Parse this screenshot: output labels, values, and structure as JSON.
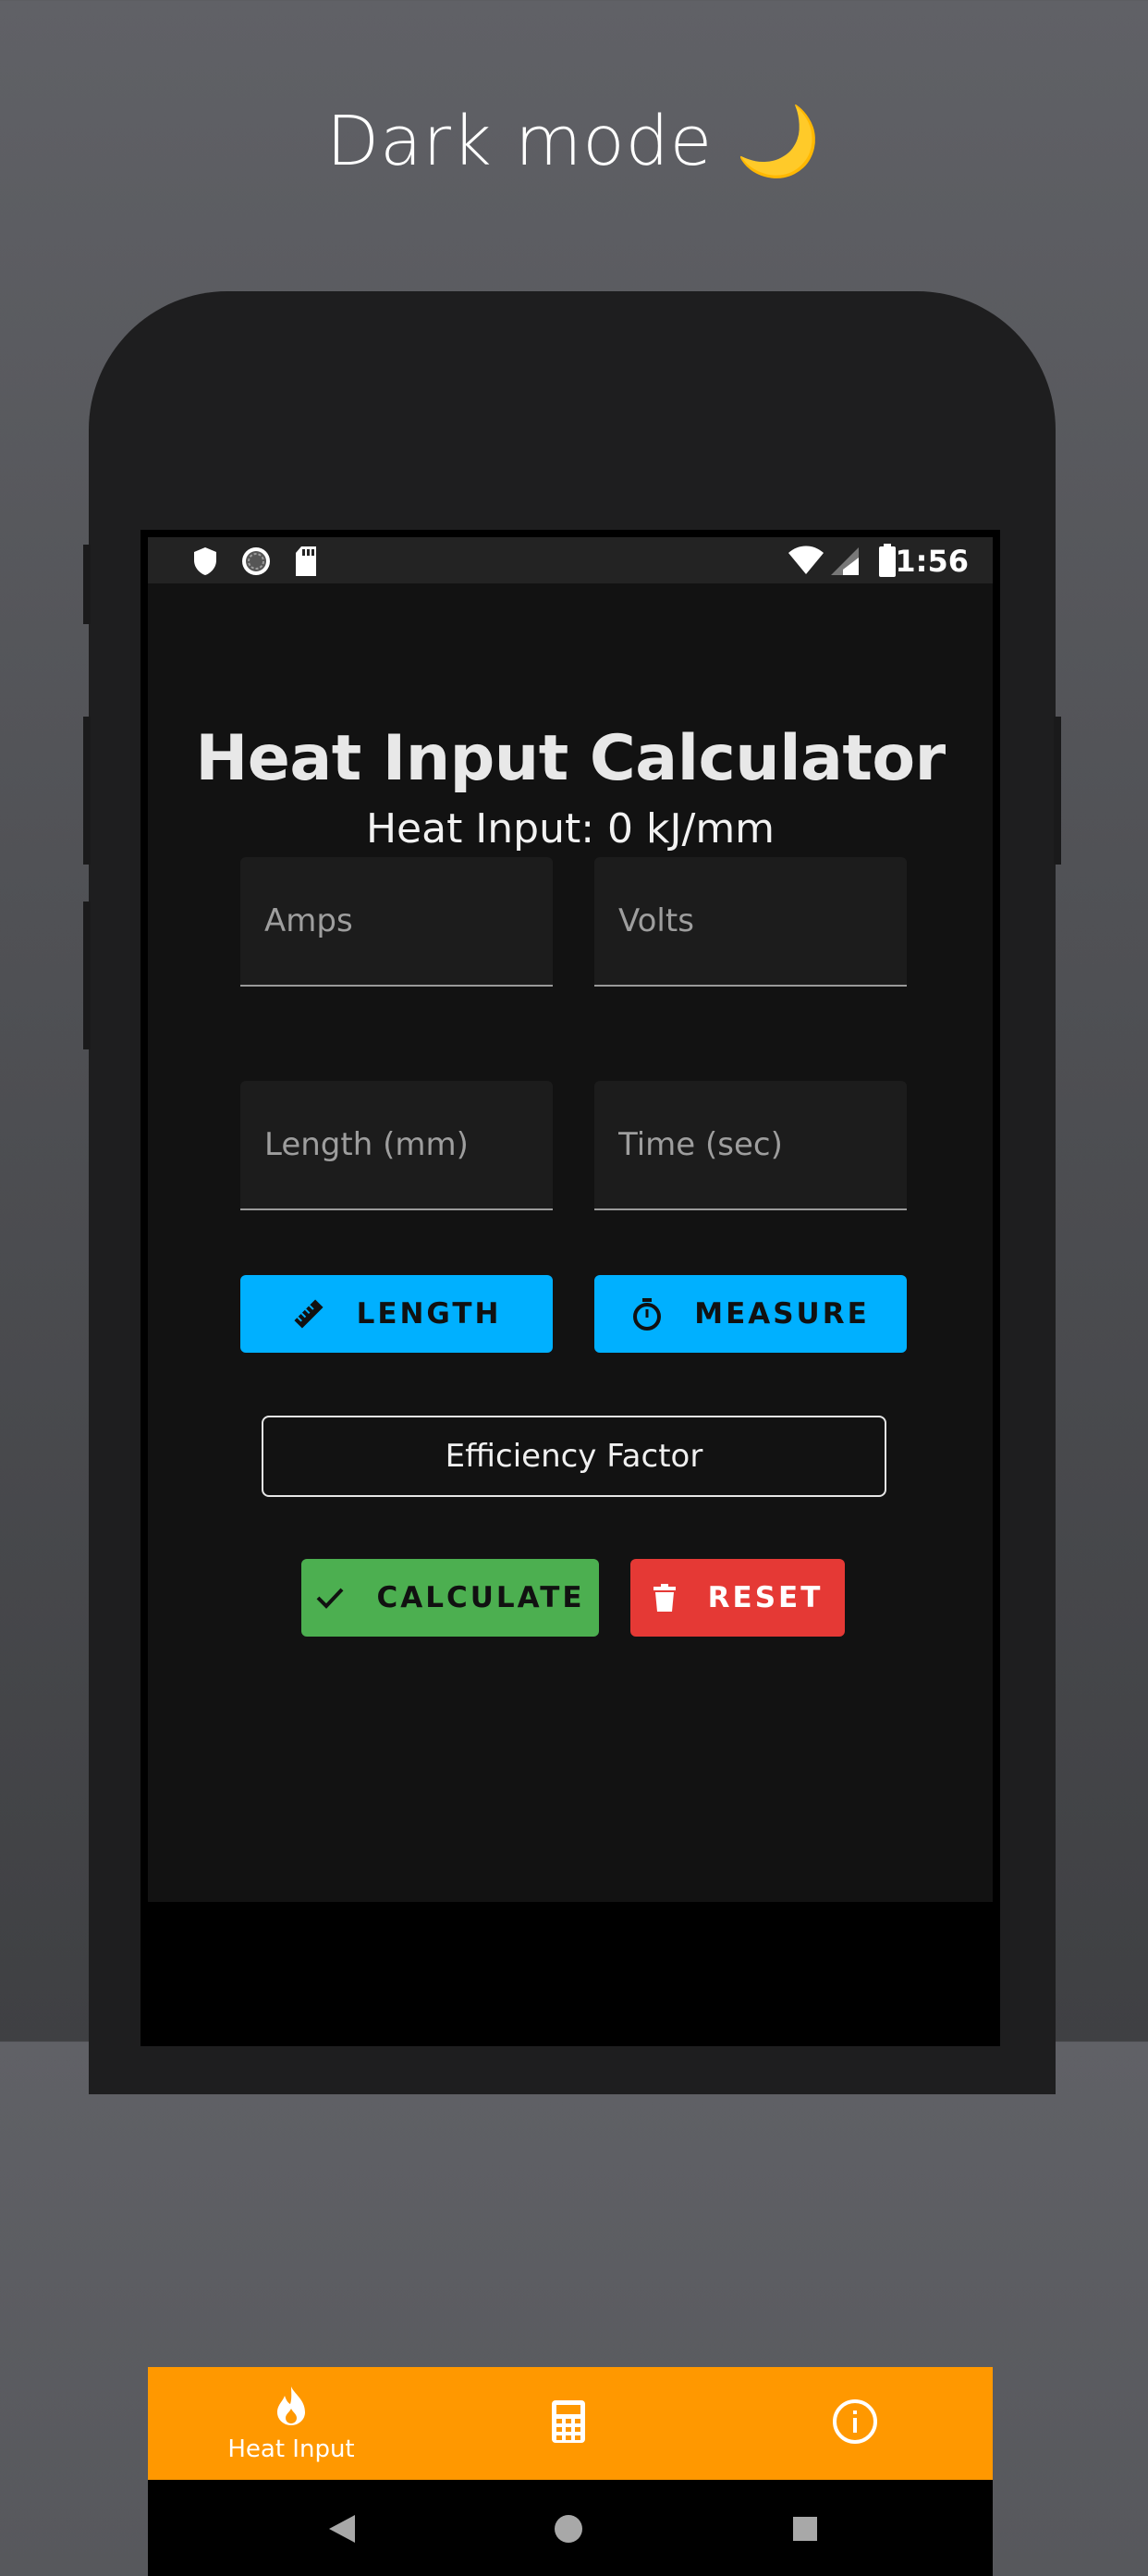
{
  "promo": {
    "title": "Dark mode 🌙"
  },
  "status_bar": {
    "time": "1:56",
    "left_icons": [
      "shield-icon",
      "sync-icon",
      "sd-card-icon"
    ],
    "right_icons": [
      "wifi-icon",
      "cell-signal-icon",
      "battery-icon"
    ]
  },
  "app": {
    "title": "Heat Input Calculator",
    "result": "Heat Input: 0 kJ/mm",
    "fields": {
      "amps_placeholder": "Amps",
      "volts_placeholder": "Volts",
      "length_placeholder": "Length (mm)",
      "time_placeholder": "Time (sec)"
    },
    "buttons": {
      "length": "LENGTH",
      "measure": "MEASURE",
      "efficiency": "Efficiency Factor",
      "calculate": "CALCULATE",
      "reset": "RESET"
    },
    "colors": {
      "accent_blue": "#00b0ff",
      "calculate_green": "#4caf50",
      "reset_red": "#e53935",
      "nav_orange": "#ff9800",
      "background": "#121212"
    }
  },
  "bottom_nav": {
    "items": [
      {
        "label": "Heat Input",
        "icon": "flame-icon",
        "active": true
      },
      {
        "label": "",
        "icon": "calculator-icon",
        "active": false
      },
      {
        "label": "",
        "icon": "info-icon",
        "active": false
      }
    ]
  },
  "system_nav": {
    "icons": [
      "back-icon",
      "home-icon",
      "recents-icon"
    ]
  }
}
